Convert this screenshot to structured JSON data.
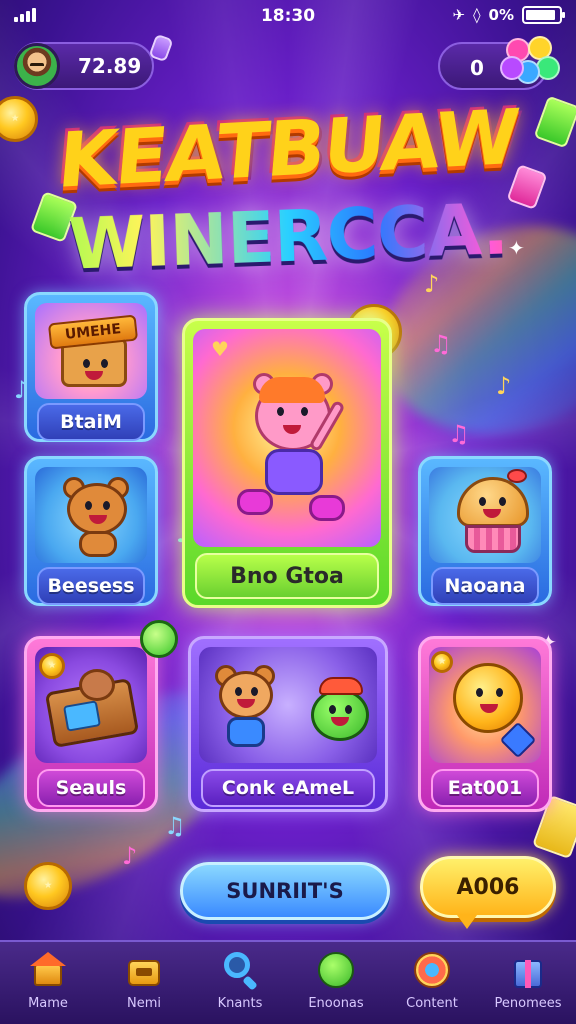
{
  "status_bar": {
    "time": "18:30",
    "battery_text": "0%",
    "battery_level": 0.9
  },
  "hud": {
    "coins": "72.89",
    "gems": "0"
  },
  "title": {
    "line1": "KEATBUAW",
    "line2": "WINERCCA."
  },
  "cards": [
    {
      "label": "BtaiM",
      "banner": "UMEHE",
      "style": "blue"
    },
    {
      "label": "Bno Gtoa",
      "style": "green"
    },
    {
      "label": "Beesess",
      "style": "blue"
    },
    {
      "label": "Naoana",
      "style": "blue"
    },
    {
      "label": "Seauls",
      "style": "pink"
    },
    {
      "label": "Conk eAmeL",
      "style": "purple"
    },
    {
      "label": "Eat001",
      "style": "pink"
    }
  ],
  "buttons": {
    "primary": "SUNRIIT'S",
    "secondary": "A006"
  },
  "bottom_nav": [
    {
      "label": "Mame",
      "icon": "house-icon"
    },
    {
      "label": "Nemi",
      "icon": "treasure-icon"
    },
    {
      "label": "Knants",
      "icon": "search-icon"
    },
    {
      "label": "Enoonas",
      "icon": "globe-icon"
    },
    {
      "label": "Content",
      "icon": "target-icon"
    },
    {
      "label": "Penomees",
      "icon": "gift-icon"
    }
  ],
  "colors": {
    "background": "#5a1cc0",
    "title_gold": "#ffd21a",
    "card_blue": "#3a8aff",
    "card_green": "#8ae83a",
    "card_pink": "#d83ac0",
    "cta_yellow": "#ffc82a"
  }
}
